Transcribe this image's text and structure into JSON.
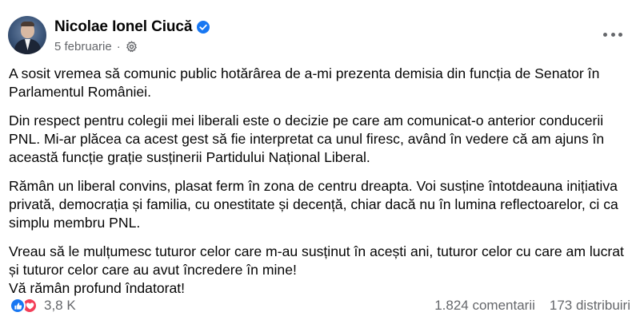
{
  "post": {
    "author": "Nicolae Ionel Ciucă",
    "date": "5 februarie",
    "separator": "·",
    "paragraphs": [
      "A sosit vremea să comunic public hotărârea de a-mi prezenta demisia din funcția de Senator în Parlamentul României.",
      "Din respect pentru colegii mei liberali este o decizie pe care am comunicat-o anterior conducerii PNL. Mi-ar plăcea ca acest gest să fie interpretat ca unul firesc, având în vedere că am ajuns în această funcție grație susținerii Partidului Național Liberal.",
      "Rămân un liberal convins, plasat ferm în zona de centru dreapta. Voi susține întotdeauna inițiativa privată, democrația și familia, cu onestitate și decență, chiar dacă nu în lumina reflectoarelor, ci ca simplu membru PNL.",
      "Vreau să le mulțumesc tuturor celor care m-au susținut în acești ani, tuturor celor cu care am lucrat și tuturor celor care au avut încredere în mine!"
    ],
    "closing": "Vă rămân profund îndatorat!",
    "reactions": {
      "count": "3,8 K",
      "types": [
        "like-icon",
        "love-icon"
      ]
    },
    "comments": "1.824 comentarii",
    "shares": "173 distribuiri"
  },
  "colors": {
    "like": "#1877f2",
    "love": "#f33e58",
    "verified": "#1877f2",
    "secondary_text": "#65676b"
  }
}
